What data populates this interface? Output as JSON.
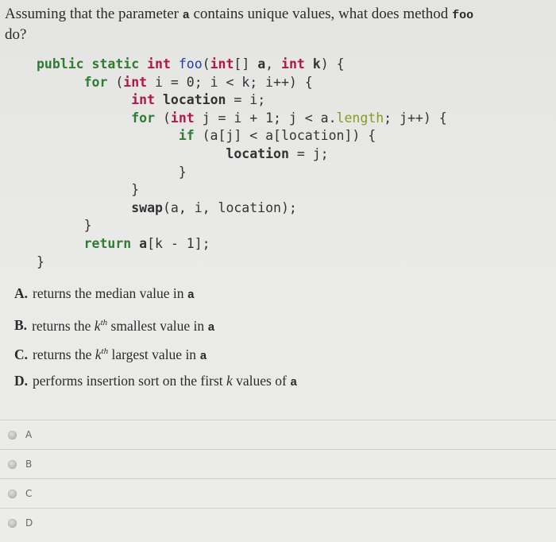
{
  "question": {
    "text_before": "Assuming that the parameter ",
    "param": "a",
    "text_middle": " contains unique values, what does method ",
    "method": "foo",
    "text_after": " do?"
  },
  "code_lines": [
    "public static int foo(int[] a, int k) {",
    "    for (int i = 0; i < k; i++) {",
    "        int location = i;",
    "        for (int j = i + 1; j < a.length; j++) {",
    "            if (a[j] < a[location]) {",
    "                location = j;",
    "            }",
    "        }",
    "        swap(a, i, location);",
    "    }",
    "    return a[k - 1];",
    "}"
  ],
  "choices": [
    {
      "label": "A.",
      "pre": "returns the median value in ",
      "sup": "",
      "post": "",
      "tail": "a"
    },
    {
      "label": "B.",
      "pre": "returns the ",
      "k": "k",
      "sup": "th",
      "post": " smallest value in ",
      "tail": "a"
    },
    {
      "label": "C.",
      "pre": "returns the ",
      "k": "k",
      "sup": "th",
      "post": " largest value in ",
      "tail": "a"
    },
    {
      "label": "D.",
      "pre": "performs insertion sort on the first ",
      "k": "k",
      "sup": "",
      "post": " values of ",
      "tail": "a"
    }
  ],
  "answer_options": [
    {
      "label": "A",
      "selected": false
    },
    {
      "label": "B",
      "selected": false
    },
    {
      "label": "C",
      "selected": false
    },
    {
      "label": "D",
      "selected": false
    }
  ]
}
